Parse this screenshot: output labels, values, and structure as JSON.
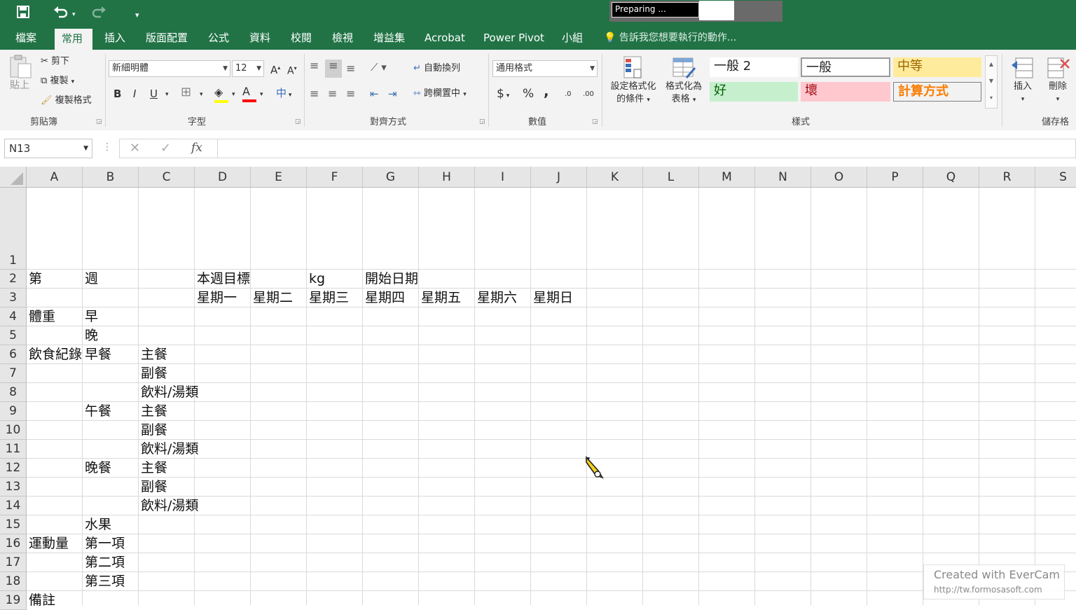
{
  "qat": {
    "save_icon": "save-icon",
    "undo_icon": "undo-icon",
    "redo_icon": "redo-icon",
    "customize_icon": "customize-icon"
  },
  "progress": {
    "text": "Preparing ..."
  },
  "tabs": [
    "檔案",
    "常用",
    "插入",
    "版面配置",
    "公式",
    "資料",
    "校閱",
    "檢視",
    "增益集",
    "Acrobat",
    "Power Pivot",
    "小組"
  ],
  "tellme": "告訴我您想要執行的動作...",
  "clipboard": {
    "paste": "貼上",
    "cut": "剪下",
    "copy": "複製",
    "format_painter": "複製格式",
    "label": "剪貼簿"
  },
  "font": {
    "name": "新細明體",
    "size": "12",
    "grow": "A",
    "shrink": "A",
    "bold": "B",
    "italic": "I",
    "underline": "U",
    "color_letter": "A",
    "phonetic": "中",
    "label": "字型"
  },
  "alignment": {
    "wrap": "自動換列",
    "merge": "跨欄置中",
    "label": "對齊方式"
  },
  "number": {
    "format": "通用格式",
    "currency": "$",
    "percent": "%",
    "comma": ",",
    "inc": ".0",
    "dec": ".00",
    "label": "數值"
  },
  "styles": {
    "cond_format": "設定格式化",
    "cond_format2": "的條件",
    "format_table": "格式化為",
    "format_table2": "表格",
    "normal2": "一般 2",
    "normal": "一般",
    "neutral": "中等",
    "good": "好",
    "bad": "壞",
    "calc": "計算方式",
    "label": "樣式"
  },
  "cells": {
    "insert": "插入",
    "delete": "刪除",
    "label": "儲存格"
  },
  "formula_bar": {
    "name_box": "N13",
    "fx": "fx",
    "content": ""
  },
  "columns": [
    "A",
    "B",
    "C",
    "D",
    "E",
    "F",
    "G",
    "H",
    "I",
    "J",
    "K",
    "L",
    "M",
    "N",
    "O",
    "P",
    "Q",
    "R",
    "S"
  ],
  "rows": [
    "1",
    "2",
    "3",
    "4",
    "5",
    "6",
    "7",
    "8",
    "9",
    "10",
    "11",
    "12",
    "13",
    "14",
    "15",
    "16",
    "17",
    "18",
    "19"
  ],
  "sheet": {
    "A2": "第",
    "B2": "週",
    "D2": "本週目標",
    "F2": "kg",
    "G2": "開始日期",
    "D3": "星期一",
    "E3": "星期二",
    "F3": "星期三",
    "G3": "星期四",
    "H3": "星期五",
    "I3": "星期六",
    "J3": "星期日",
    "A4": "體重",
    "B4": "早",
    "B5": "晚",
    "A6": "飲食紀錄",
    "B6": "早餐",
    "C6": "主餐",
    "C7": "副餐",
    "C8": "飲料/湯類",
    "B9": "午餐",
    "C9": "主餐",
    "C10": "副餐",
    "C11": "飲料/湯類",
    "B12": "晚餐",
    "C12": "主餐",
    "C13": "副餐",
    "C14": "飲料/湯類",
    "B15": "水果",
    "A16": "運動量",
    "B16": "第一項",
    "B17": "第二項",
    "B18": "第三項",
    "A19": "備註"
  },
  "watermark": {
    "line1": "Created with EverCam",
    "line2": "http://tw.formosasoft.com"
  },
  "colors": {
    "excel_green": "#217346",
    "good_bg": "#c6efce",
    "bad_bg": "#ffc7ce",
    "neutral_bg": "#ffeb9c"
  }
}
